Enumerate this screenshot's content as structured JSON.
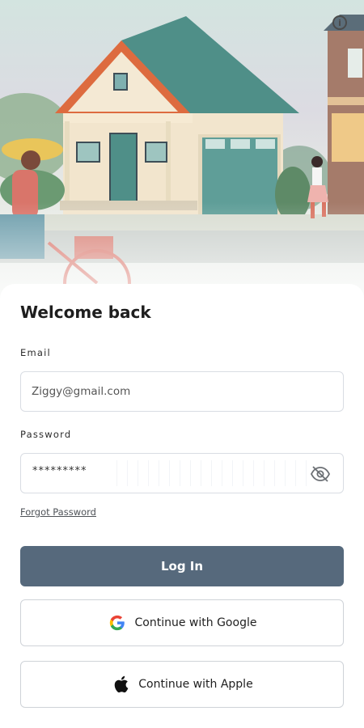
{
  "hero": {
    "info_icon": "info-icon"
  },
  "login": {
    "title": "Welcome back",
    "email_label": "Email",
    "email_value": "Ziggy@gmail.com",
    "password_label": "Password",
    "password_masked": "*********",
    "forgot_label": "Forgot Password",
    "login_button": "Log In",
    "google_button": "Continue with Google",
    "apple_button": "Continue with Apple"
  },
  "colors": {
    "primary_button": "#56697c",
    "border": "#d9dde3",
    "accent_roof": "#dd6b3f",
    "accent_teal": "#4f8f88"
  }
}
